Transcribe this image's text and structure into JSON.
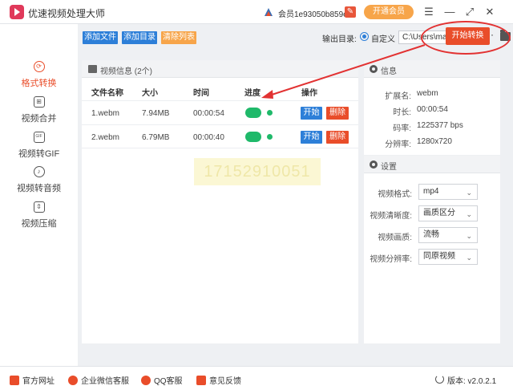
{
  "app": {
    "title": "优速视频处理大师"
  },
  "titlebar": {
    "user_label": "会员1e93050b859e",
    "vip_label": "开通会员",
    "menu_icon": "menu-icon",
    "minimize_icon": "minimize-icon",
    "restore_icon": "restore-icon",
    "close_icon": "close-icon"
  },
  "toolbar": {
    "add_file": "添加文件",
    "add_dir": "添加目录",
    "clear_list": "清除列表",
    "output_label": "输出目录:",
    "custom_label": "自定义",
    "path_value": "C:\\Users\\mayn\\Desktop",
    "dots": "···",
    "start_all": "开始转换"
  },
  "sidebar": {
    "items": [
      {
        "label": "格式转换",
        "icon": "refresh-icon"
      },
      {
        "label": "视频合并",
        "icon": "merge-icon"
      },
      {
        "label": "视频转GIF",
        "icon": "gif-icon"
      },
      {
        "label": "视频转音频",
        "icon": "audio-icon"
      },
      {
        "label": "视频压缩",
        "icon": "compress-icon"
      }
    ]
  },
  "list": {
    "title": "视频信息 (2个)",
    "columns": {
      "name": "文件名称",
      "size": "大小",
      "time": "时间",
      "progress": "进度",
      "action": "操作"
    },
    "rows": [
      {
        "name": "1.webm",
        "size": "7.94MB",
        "time": "00:00:54",
        "start": "开始",
        "delete": "删除"
      },
      {
        "name": "2.webm",
        "size": "6.79MB",
        "time": "00:00:40",
        "start": "开始",
        "delete": "删除"
      }
    ],
    "watermark": "17152910051"
  },
  "info": {
    "title": "信息",
    "items": [
      {
        "key": "扩展名:",
        "value": "webm"
      },
      {
        "key": "时长:",
        "value": "00:00:54"
      },
      {
        "key": "码率:",
        "value": "1225377 bps"
      },
      {
        "key": "分辨率:",
        "value": "1280x720"
      }
    ]
  },
  "settings": {
    "title": "设置",
    "items": [
      {
        "key": "视频格式:",
        "value": "mp4"
      },
      {
        "key": "视频清晰度:",
        "value": "画质区分"
      },
      {
        "key": "视频画质:",
        "value": "流畅"
      },
      {
        "key": "视频分辨率:",
        "value": "同原视频"
      }
    ]
  },
  "footer": {
    "site": "官方网址",
    "wechat": "企业微信客服",
    "qq": "QQ客服",
    "feedback": "意见反馈",
    "version": "版本: v2.0.2.1"
  },
  "colors": {
    "accent_red": "#e94d2a",
    "button_blue": "#2d7fd8",
    "button_orange": "#f7a54a",
    "toggle_green": "#1fb96a"
  }
}
